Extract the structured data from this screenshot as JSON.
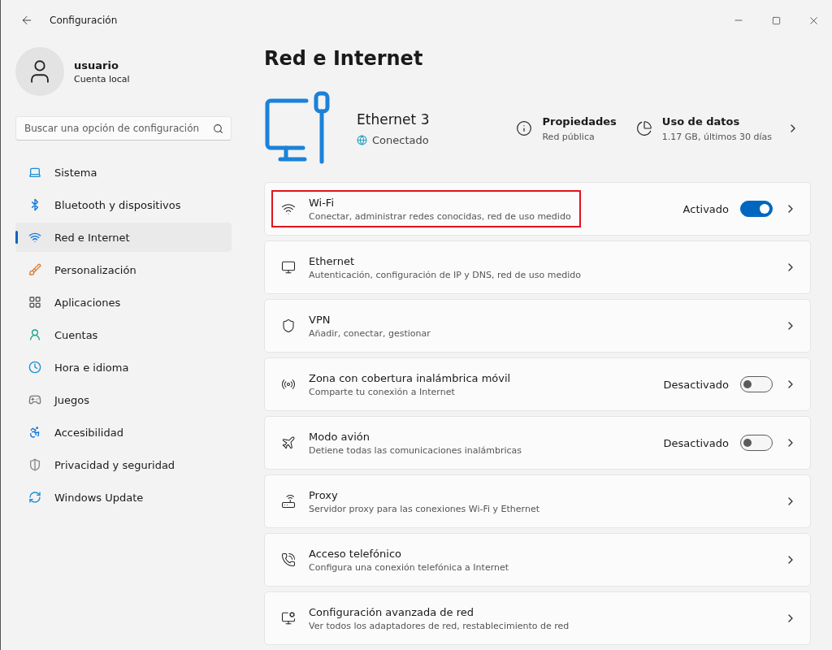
{
  "window": {
    "title": "Configuración"
  },
  "profile": {
    "name": "usuario",
    "account": "Cuenta local"
  },
  "search": {
    "placeholder": "Buscar una opción de configuración"
  },
  "nav": [
    {
      "label": "Sistema",
      "kind": "system",
      "selected": false
    },
    {
      "label": "Bluetooth y dispositivos",
      "kind": "bluetooth",
      "selected": false
    },
    {
      "label": "Red e Internet",
      "kind": "network",
      "selected": true
    },
    {
      "label": "Personalización",
      "kind": "brush",
      "selected": false
    },
    {
      "label": "Aplicaciones",
      "kind": "apps",
      "selected": false
    },
    {
      "label": "Cuentas",
      "kind": "accounts",
      "selected": false
    },
    {
      "label": "Hora e idioma",
      "kind": "time",
      "selected": false
    },
    {
      "label": "Juegos",
      "kind": "games",
      "selected": false
    },
    {
      "label": "Accesibilidad",
      "kind": "accessibility",
      "selected": false
    },
    {
      "label": "Privacidad y seguridad",
      "kind": "privacy",
      "selected": false
    },
    {
      "label": "Windows Update",
      "kind": "update",
      "selected": false
    }
  ],
  "page": {
    "title": "Red e Internet"
  },
  "connection": {
    "name": "Ethernet 3",
    "status": "Conectado",
    "properties": {
      "title": "Propiedades",
      "subtitle": "Red pública"
    },
    "data_usage": {
      "title": "Uso de datos",
      "subtitle": "1.17 GB, últimos 30 días"
    }
  },
  "settings": [
    {
      "kind": "toggle",
      "title": "Wi-Fi",
      "subtitle": "Conectar, administrar redes conocidas, red de uso medido",
      "state_label": "Activado",
      "on": true,
      "highlighted": true
    },
    {
      "kind": "link",
      "title": "Ethernet",
      "subtitle": "Autenticación, configuración de IP y DNS, red de uso medido",
      "highlighted": false
    },
    {
      "kind": "link",
      "title": "VPN",
      "subtitle": "Añadir, conectar, gestionar",
      "highlighted": false
    },
    {
      "kind": "toggle",
      "title": "Zona con cobertura inalámbrica móvil",
      "subtitle": "Comparte tu conexión a Internet",
      "state_label": "Desactivado",
      "on": false,
      "highlighted": false
    },
    {
      "kind": "toggle",
      "title": "Modo avión",
      "subtitle": "Detiene todas las comunicaciones inalámbricas",
      "state_label": "Desactivado",
      "on": false,
      "highlighted": false
    },
    {
      "kind": "link",
      "title": "Proxy",
      "subtitle": "Servidor proxy para las conexiones Wi-Fi y Ethernet",
      "highlighted": false
    },
    {
      "kind": "link",
      "title": "Acceso telefónico",
      "subtitle": "Configura una conexión telefónica a Internet",
      "highlighted": false
    },
    {
      "kind": "link",
      "title": "Configuración avanzada de red",
      "subtitle": "Ver todos los adaptadores de red, restablecimiento de red",
      "highlighted": false
    }
  ]
}
